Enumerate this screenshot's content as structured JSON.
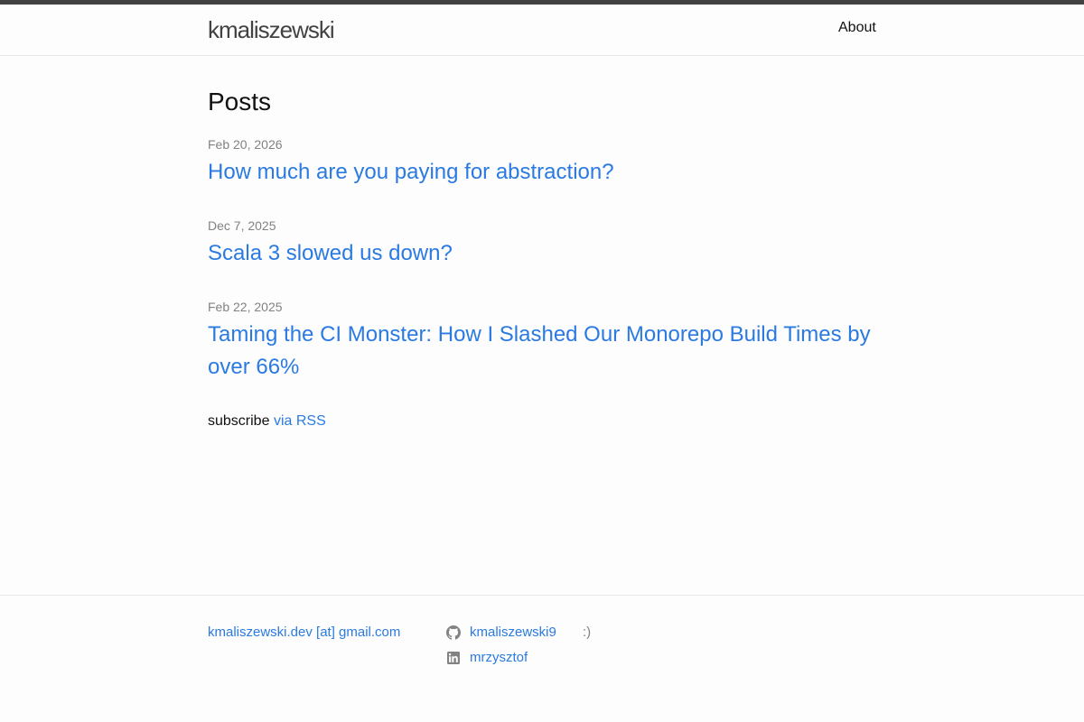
{
  "header": {
    "site_title": "kmaliszewski",
    "nav": [
      {
        "label": "About"
      }
    ]
  },
  "main": {
    "heading": "Posts",
    "posts": [
      {
        "date": "Feb 20, 2026",
        "title": "How much are you paying for abstraction?"
      },
      {
        "date": "Dec 7, 2025",
        "title": "Scala 3 slowed us down?"
      },
      {
        "date": "Feb 22, 2025",
        "title": "Taming the CI Monster: How I Slashed Our Monorepo Build Times by over 66%"
      }
    ],
    "rss": {
      "prefix": "subscribe",
      "link_label": "via RSS"
    }
  },
  "footer": {
    "email": "kmaliszewski.dev [at] gmail.com",
    "social": [
      {
        "icon": "github-icon",
        "label": "kmaliszewski9"
      },
      {
        "icon": "linkedin-icon",
        "label": "mrzysztof"
      }
    ],
    "note": ":)"
  },
  "colors": {
    "link": "#2a7ae2",
    "meta_text": "#828282",
    "top_stripe": "#424242",
    "background": "#fdfdfd"
  }
}
